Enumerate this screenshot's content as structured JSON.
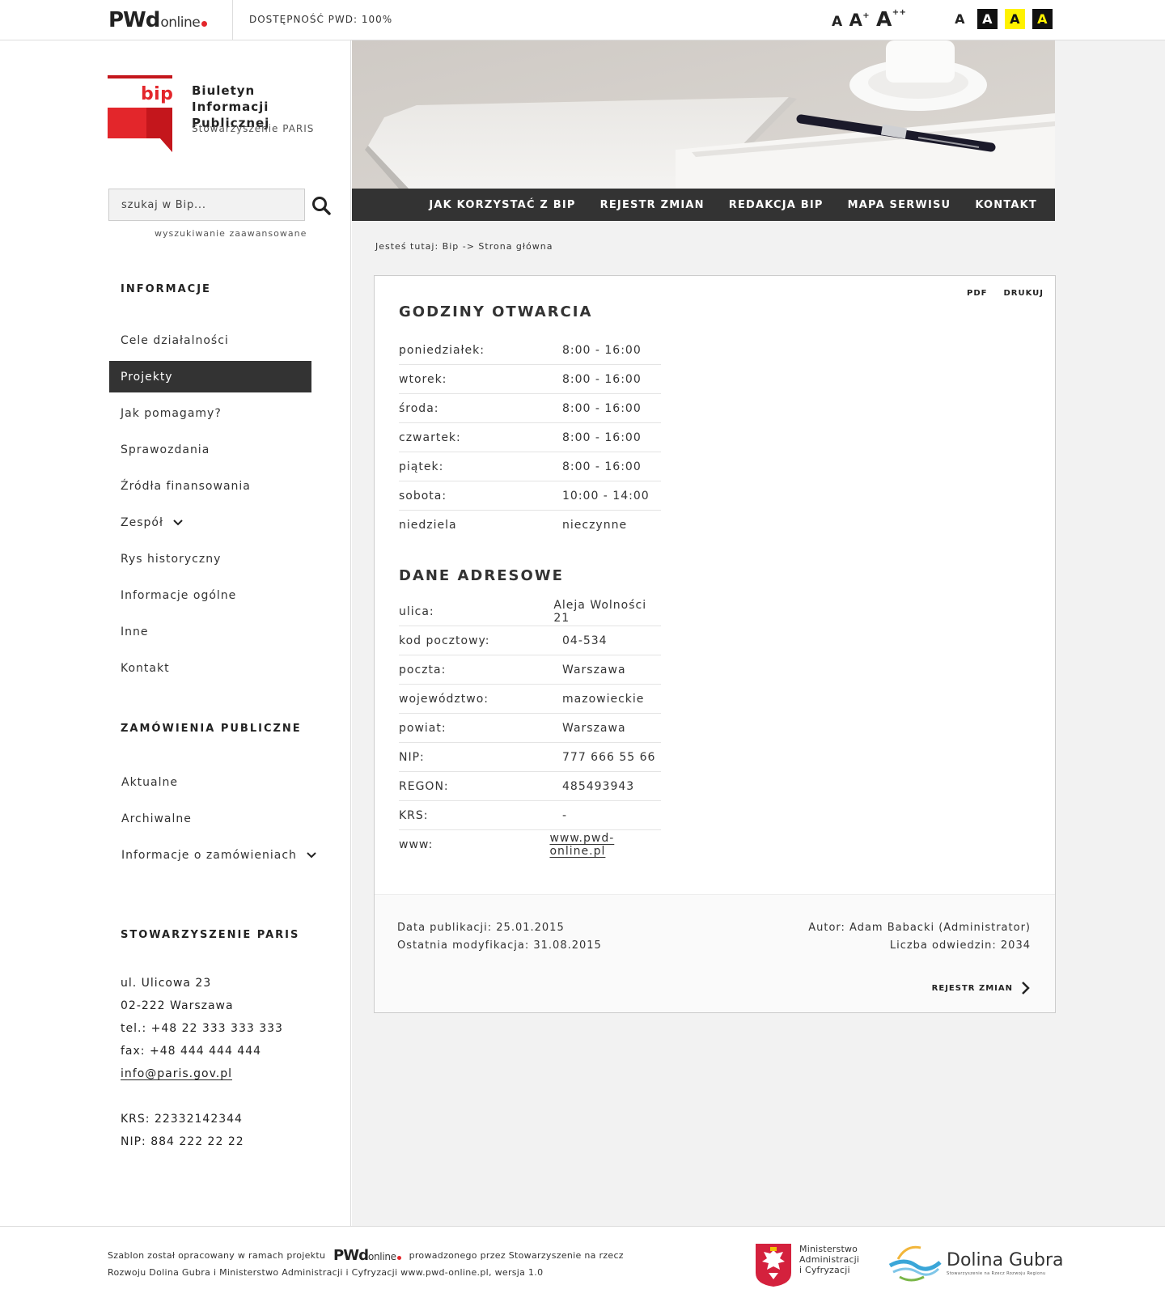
{
  "topbar": {
    "logo_pwd": "PWd",
    "logo_online": "online",
    "accessibility": "DOSTĘPNOŚĆ PWD: 100%",
    "font_sizes": [
      "A",
      "A",
      "A"
    ],
    "font_size_marks": [
      "+",
      "++"
    ],
    "contrast_options": [
      "A",
      "A",
      "A",
      "A"
    ]
  },
  "sidebar": {
    "bip_title": "Biuletyn Informacji Publicznej",
    "bip_logo_text": "bip",
    "bip_subtitle": "Stowarzyszenie PARIS",
    "search_placeholder": "szukaj w Bip...",
    "advanced_search": "wyszukiwanie zaawansowane",
    "section_info": "INFORMACJE",
    "info_items": [
      "Cele działalności",
      "Projekty",
      "Jak pomagamy?",
      "Sprawozdania",
      "Źródła finansowania",
      "Zespół",
      "Rys historyczny",
      "Informacje ogólne",
      "Inne",
      "Kontakt"
    ],
    "section_orders": "ZAMÓWIENIA PUBLICZNE",
    "order_items": [
      "Aktualne",
      "Archiwalne",
      "Informacje o zamówieniach"
    ],
    "section_org": "STOWARZYSZENIE PARIS",
    "address": [
      "ul. Ulicowa 23",
      "02-222 Warszawa",
      "tel.: +48 22 333 333 333",
      "fax: +48 444 444 444",
      "info@paris.gov.pl"
    ],
    "registry": [
      "KRS: 22332142344",
      "NIP: 884 222 22 22"
    ]
  },
  "nav": [
    "JAK KORZYSTAĆ Z BIP",
    "REJESTR ZMIAN",
    "REDAKCJA BIP",
    "MAPA SERWISU",
    "KONTAKT"
  ],
  "breadcrumb": "Jesteś tutaj: Bip -> Strona główna",
  "card": {
    "actions": [
      "PDF",
      "DRUKUJ"
    ],
    "hours_title": "GODZINY OTWARCIA",
    "hours": [
      [
        "poniedziałek:",
        "8:00 - 16:00"
      ],
      [
        "wtorek:",
        "8:00 - 16:00"
      ],
      [
        "środa:",
        "8:00 - 16:00"
      ],
      [
        "czwartek:",
        "8:00 - 16:00"
      ],
      [
        "piątek:",
        "8:00 - 16:00"
      ],
      [
        "sobota:",
        "10:00 - 14:00"
      ],
      [
        "niedziela",
        "nieczynne"
      ]
    ],
    "address_title": "DANE ADRESOWE",
    "address": [
      [
        "ulica:",
        "Aleja Wolności 21"
      ],
      [
        "kod pocztowy:",
        "04-534"
      ],
      [
        "poczta:",
        "Warszawa"
      ],
      [
        "województwo:",
        "mazowieckie"
      ],
      [
        "powiat:",
        "Warszawa"
      ],
      [
        "NIP:",
        "777 666 55 66"
      ],
      [
        "REGON:",
        "485493943"
      ],
      [
        "KRS:",
        "-"
      ],
      [
        "www:",
        "www.pwd-online.pl"
      ]
    ],
    "published": "Data publikacji: 25.01.2015",
    "modified": "Ostatnia modyfikacja: 31.08.2015",
    "author": "Autor: Adam Babacki (Administrator)",
    "visits": "Liczba odwiedzin: 2034",
    "registry_link": "REJESTR ZMIAN"
  },
  "footer": {
    "text_before": "Szablon został opracowany w ramach projektu",
    "text_after": "prowadzonego przez Stowarzyszenie na rzecz",
    "text_line2": "Rozwoju Dolina Gubra i Ministerstwo Administracji i Cyfryzacji www.pwd-online.pl, wersja 1.0",
    "ministry": [
      "Ministerstwo",
      "Administracji",
      "i Cyfryzacji"
    ],
    "dg_name": "Dolina Gubra",
    "dg_sub": "Stowarzyszenie na Rzecz Rozwoju Regionu"
  },
  "colors": {
    "accent_red": "#e3262b",
    "dark": "#333333",
    "yellow": "#fff200"
  }
}
